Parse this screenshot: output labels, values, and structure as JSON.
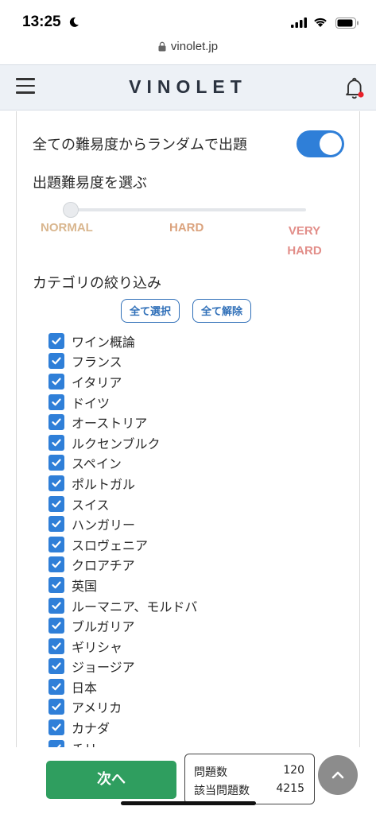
{
  "status_bar": {
    "time": "13:25"
  },
  "browser": {
    "url": "vinolet.jp"
  },
  "header": {
    "brand": "VINOLET",
    "notification_color": "#e8212a"
  },
  "settings": {
    "random_label": "全ての難易度からランダムで出題",
    "random_enabled": true,
    "difficulty_title": "出題難易度を選ぶ",
    "difficulty_levels": {
      "normal": "NORMAL",
      "hard": "HARD",
      "very_hard": "VERY HARD"
    },
    "difficulty_value": "NORMAL",
    "category_title": "カテゴリの絞り込み",
    "select_all_label": "全て選択",
    "clear_all_label": "全て解除"
  },
  "categories": [
    {
      "label": "ワイン概論",
      "checked": true
    },
    {
      "label": "フランス",
      "checked": true
    },
    {
      "label": "イタリア",
      "checked": true
    },
    {
      "label": "ドイツ",
      "checked": true
    },
    {
      "label": "オーストリア",
      "checked": true
    },
    {
      "label": "ルクセンブルク",
      "checked": true
    },
    {
      "label": "スペイン",
      "checked": true
    },
    {
      "label": "ポルトガル",
      "checked": true
    },
    {
      "label": "スイス",
      "checked": true
    },
    {
      "label": "ハンガリー",
      "checked": true
    },
    {
      "label": "スロヴェニア",
      "checked": true
    },
    {
      "label": "クロアチア",
      "checked": true
    },
    {
      "label": "英国",
      "checked": true
    },
    {
      "label": "ルーマニア、モルドバ",
      "checked": true
    },
    {
      "label": "ブルガリア",
      "checked": true
    },
    {
      "label": "ギリシャ",
      "checked": true
    },
    {
      "label": "ジョージア",
      "checked": true
    },
    {
      "label": "日本",
      "checked": true
    },
    {
      "label": "アメリカ",
      "checked": true
    },
    {
      "label": "カナダ",
      "checked": true
    },
    {
      "label": "チリ",
      "checked": true
    }
  ],
  "footer": {
    "next_label": "次へ",
    "question_count_label": "問題数",
    "question_count": "120",
    "matching_count_label": "該当問題数",
    "matching_count": "4215"
  },
  "colors": {
    "accent": "#2f7fd8",
    "next_button": "#2f9e5f",
    "normal": "#d9b68e",
    "hard": "#dba37e",
    "very_hard": "#e28e89"
  }
}
